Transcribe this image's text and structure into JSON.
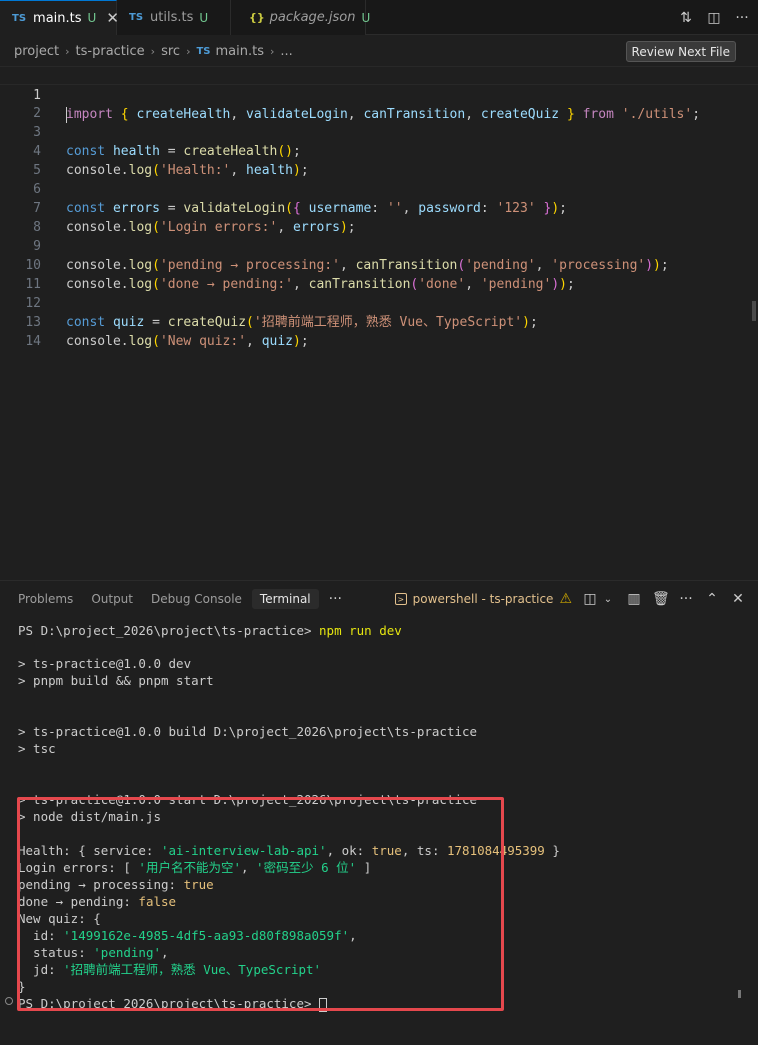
{
  "tabs": [
    {
      "icon": "TS",
      "label": "main.ts",
      "status": "U",
      "active": true
    },
    {
      "icon": "TS",
      "label": "utils.ts",
      "status": "U",
      "active": false
    },
    {
      "icon": "{}",
      "label": "package.json",
      "status": "U",
      "active": false
    }
  ],
  "breadcrumb": [
    "project",
    "ts-practice",
    "src",
    "main.ts",
    "..."
  ],
  "breadcrumb_file_icon": "TS",
  "review_button": "Review Next File",
  "editor": {
    "line_numbers": [
      "1",
      "2",
      "3",
      "4",
      "5",
      "6",
      "7",
      "8",
      "9",
      "10",
      "11",
      "12",
      "13",
      "14"
    ],
    "lines": {
      "l1": {
        "kw": "import",
        "open": "{",
        "a": "createHealth",
        "b": "validateLogin",
        "c": "canTransition",
        "d": "createQuiz",
        "close": "}",
        "from": "from",
        "path": "'./utils'"
      },
      "l3": {
        "kw": "const",
        "var": "health",
        "fn": "createHealth"
      },
      "l4": {
        "obj": "console",
        "fn": "log",
        "str": "'Health:'",
        "arg": "health"
      },
      "l6": {
        "kw": "const",
        "var": "errors",
        "fn": "validateLogin",
        "k1": "username",
        "v1": "''",
        "k2": "password",
        "v2": "'123'"
      },
      "l7": {
        "obj": "console",
        "fn": "log",
        "str": "'Login errors:'",
        "arg": "errors"
      },
      "l9": {
        "obj": "console",
        "fn": "log",
        "str": "'pending → processing:'",
        "fn2": "canTransition",
        "a1": "'pending'",
        "a2": "'processing'"
      },
      "l10": {
        "obj": "console",
        "fn": "log",
        "str": "'done → pending:'",
        "fn2": "canTransition",
        "a1": "'done'",
        "a2": "'pending'"
      },
      "l12": {
        "kw": "const",
        "var": "quiz",
        "fn": "createQuiz",
        "str": "'招聘前端工程师，熟悉 Vue、TypeScript'"
      },
      "l13": {
        "obj": "console",
        "fn": "log",
        "str": "'New quiz:'",
        "arg": "quiz"
      }
    }
  },
  "panel": {
    "tabs": [
      "Problems",
      "Output",
      "Debug Console",
      "Terminal",
      "···"
    ],
    "active_tab": "Terminal",
    "shell_label": "powershell - ts-practice"
  },
  "terminal": {
    "prompt1": "PS D:\\project_2026\\project\\ts-practice>",
    "cmd1": "npm run dev",
    "l_dev1": "> ts-practice@1.0.0 dev",
    "l_dev2": "> pnpm build && pnpm start",
    "l_build1": "> ts-practice@1.0.0 build D:\\project_2026\\project\\ts-practice",
    "l_build2": "> tsc",
    "l_start1": "> ts-practice@1.0.0 start D:\\project_2026\\project\\ts-practice",
    "l_start2": "> node dist/main.js",
    "health": {
      "prefix": "Health: { service: ",
      "service": "'ai-interview-lab-api'",
      "ok_key": ", ok: ",
      "ok": "true",
      "ts_key": ", ts: ",
      "ts": "1781084495399",
      "suffix": " }"
    },
    "login": {
      "prefix": "Login errors: [ ",
      "e1": "'用户名不能为空'",
      "sep": ", ",
      "e2": "'密码至少 6 位'",
      "suffix": " ]"
    },
    "pending": {
      "label": "pending → processing: ",
      "value": "true"
    },
    "done": {
      "label": "done → pending: ",
      "value": "false"
    },
    "quiz_open": "New quiz: {",
    "quiz_id": {
      "key": "  id: ",
      "value": "'1499162e-4985-4df5-aa93-d80f898a059f'",
      "comma": ","
    },
    "quiz_status": {
      "key": "  status: ",
      "value": "'pending'",
      "comma": ","
    },
    "quiz_jd": {
      "key": "  jd: ",
      "value": "'招聘前端工程师，熟悉 Vue、TypeScript'"
    },
    "quiz_close": "}",
    "prompt2": "PS D:\\project_2026\\project\\ts-practice>"
  }
}
